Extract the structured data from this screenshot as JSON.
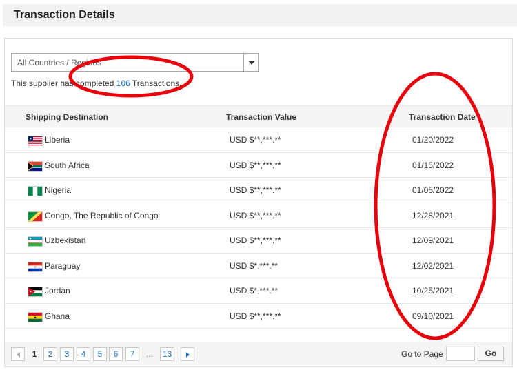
{
  "header": {
    "title": "Transaction Details"
  },
  "filter": {
    "selected": "All Countries / Regions"
  },
  "summary": {
    "prefix": "This supplier has completed",
    "count": "106",
    "suffix": "Transactions."
  },
  "table": {
    "columns": [
      "Shipping Destination",
      "Transaction Value",
      "Transaction Date"
    ],
    "rows": [
      {
        "country": "Liberia",
        "flag": "liberia-flag-icon",
        "value": "USD $**,***.**",
        "date": "01/20/2022"
      },
      {
        "country": "South Africa",
        "flag": "south-africa-flag-icon",
        "value": "USD $**,***.**",
        "date": "01/15/2022"
      },
      {
        "country": "Nigeria",
        "flag": "nigeria-flag-icon",
        "value": "USD $**,***.**",
        "date": "01/05/2022"
      },
      {
        "country": "Congo, The Republic of Congo",
        "flag": "congo-flag-icon",
        "value": "USD $**,***.**",
        "date": "12/28/2021"
      },
      {
        "country": "Uzbekistan",
        "flag": "uzbekistan-flag-icon",
        "value": "USD $**,***.**",
        "date": "12/09/2021"
      },
      {
        "country": "Paraguay",
        "flag": "paraguay-flag-icon",
        "value": "USD $*,***.**",
        "date": "12/02/2021"
      },
      {
        "country": "Jordan",
        "flag": "jordan-flag-icon",
        "value": "USD $*,***.**",
        "date": "10/25/2021"
      },
      {
        "country": "Ghana",
        "flag": "ghana-flag-icon",
        "value": "USD $**,***.**",
        "date": "09/10/2021"
      }
    ]
  },
  "pagination": {
    "pages": [
      "1",
      "2",
      "3",
      "4",
      "5",
      "6",
      "7",
      "...",
      "13"
    ],
    "current": "1",
    "goto_label": "Go to Page",
    "goto_value": "",
    "go_label": "Go"
  },
  "colors": {
    "link": "#1a6fc4",
    "annotation": "#e8000b"
  }
}
